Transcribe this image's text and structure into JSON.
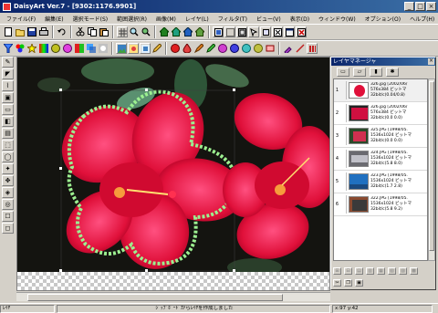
{
  "window": {
    "title": "DaisyArt Ver.7 - [9302:1176.9901]",
    "buttons": [
      "_",
      "□",
      "×"
    ]
  },
  "menu": [
    "ファイル(F)",
    "編集(E)",
    "選択モード(S)",
    "範囲選択(R)",
    "画像(M)",
    "レイヤ(L)",
    "フィルタ(T)",
    "ビュー(V)",
    "表示(D)",
    "ウィンドウ(W)",
    "オプション(O)",
    "ヘルプ(H)"
  ],
  "toolbar1": [
    "new-icon",
    "open-icon",
    "save-icon",
    "print-icon",
    "undo-icon",
    "cut-icon",
    "copy-icon",
    "paste-icon",
    "zoom-in-icon",
    "zoom-out-icon",
    "home-icon",
    "layout-icon",
    "frame-icon",
    "crop-icon",
    "close-icon"
  ],
  "toolbar2": [
    "filter-icon",
    "palette-icon",
    "brush-icon",
    "color-icon",
    "fill-icon",
    "eyedropper-icon"
  ],
  "layer_manager": {
    "title": "レイヤマネージャ",
    "layers": [
      {
        "num": "1",
        "line1": "326.jpg [2002/06/",
        "line2": "576x384 ビットマ",
        "line3": "32bit/c(0.04/0.8)"
      },
      {
        "num": "2",
        "line1": "326.jpg [2002/06/",
        "line2": "576x384 ビットマ",
        "line3": "32bit/c(0.0 0.0)"
      },
      {
        "num": "3",
        "line1": "325.JPG [1998/05.",
        "line2": "1536x1024 ビットマ",
        "line3": "32bit/c(0.0 0.0)"
      },
      {
        "num": "4",
        "line1": "324.JPG [1998/05.",
        "line2": "1536x1024 ビットマ",
        "line3": "32bit/c(5.8 8.0)"
      },
      {
        "num": "5",
        "line1": "323.JPG [1998/05.",
        "line2": "1536x1024 ビットマ",
        "line3": "32bit/c(1.7 2.8)"
      },
      {
        "num": "6",
        "line1": "322.JPG [1998/05.",
        "line2": "1536x1024 ビットマ",
        "line3": "32bit/c(5.8 9.2)"
      }
    ]
  },
  "status": {
    "left": "ﾚｲﾔ",
    "message": "ｼﾞｯﾌﾟﾎﾞｰﾄﾞからﾚｲﾔを作成しました",
    "coords": "x:97 y:42"
  }
}
